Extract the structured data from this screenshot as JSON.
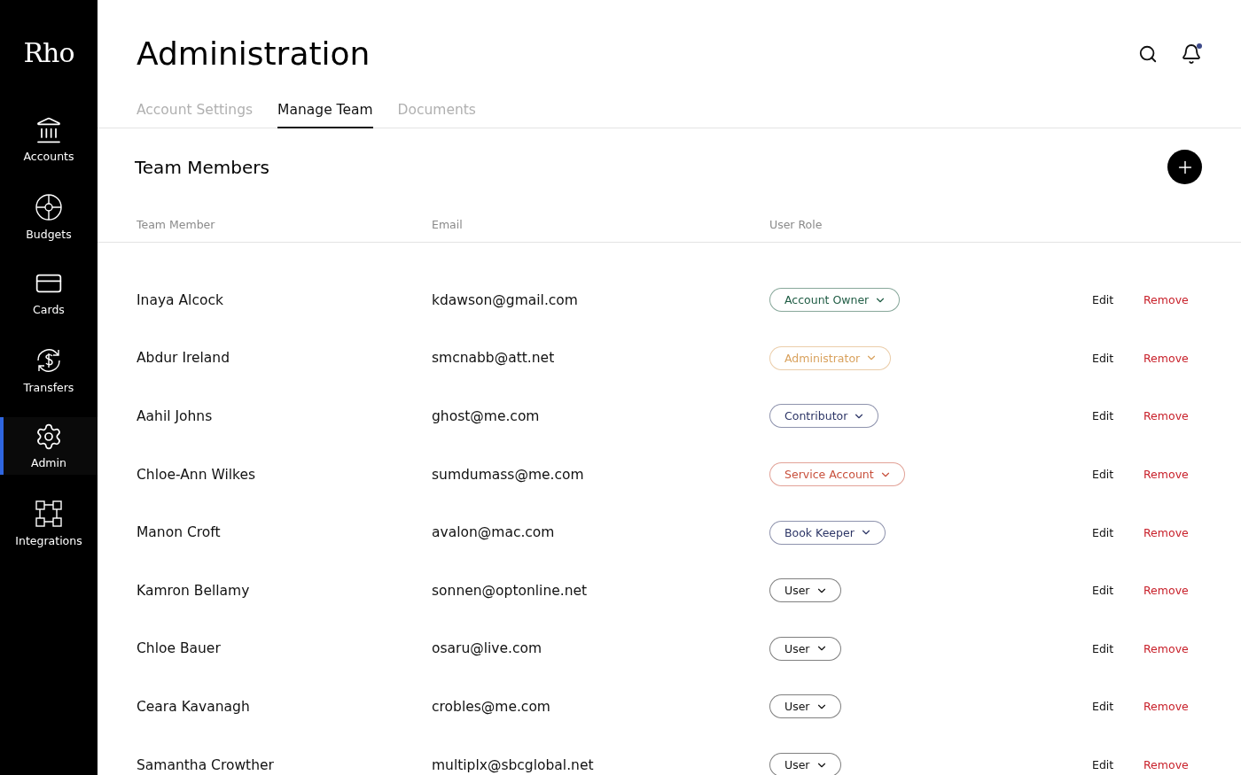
{
  "sidebar": {
    "logo": "Rho",
    "items": [
      {
        "label": "Accounts",
        "kind": "accounts",
        "selected": false
      },
      {
        "label": "Budgets",
        "kind": "budgets",
        "selected": false
      },
      {
        "label": "Cards",
        "kind": "cards",
        "selected": false
      },
      {
        "label": "Transfers",
        "kind": "transfers",
        "selected": false
      },
      {
        "label": "Admin",
        "kind": "admin",
        "selected": true
      },
      {
        "label": "Integrations",
        "kind": "integrations",
        "selected": false
      }
    ]
  },
  "header": {
    "title": "Administration",
    "notification_dot": true
  },
  "tabs": [
    {
      "label": "Account Settings",
      "selected": false
    },
    {
      "label": "Manage Team",
      "selected": true
    },
    {
      "label": "Documents",
      "selected": false
    }
  ],
  "section": {
    "title": "Team Members"
  },
  "table": {
    "columns": [
      "Team Member",
      "Email",
      "User Role"
    ],
    "rows": [
      {
        "name": "Inaya Alcock",
        "email": "kdawson@gmail.com",
        "role": "Account Owner",
        "color": "#1f5c44",
        "edit": "Edit",
        "remove": "Remove"
      },
      {
        "name": "Abdur Ireland",
        "email": "smcnabb@att.net",
        "role": "Administrator",
        "color": "#d9a25e",
        "edit": "Edit",
        "remove": "Remove"
      },
      {
        "name": "Aahil Johns",
        "email": "ghost@me.com",
        "role": "Contributor",
        "color": "#2c3566",
        "edit": "Edit",
        "remove": "Remove"
      },
      {
        "name": "Chloe-Ann Wilkes",
        "email": "sumdumass@me.com",
        "role": "Service Account",
        "color": "#c8503c",
        "edit": "Edit",
        "remove": "Remove"
      },
      {
        "name": "Manon Croft",
        "email": "avalon@mac.com",
        "role": "Book Keeper",
        "color": "#2c3566",
        "edit": "Edit",
        "remove": "Remove"
      },
      {
        "name": "Kamron Bellamy",
        "email": "sonnen@optonline.net",
        "role": "User",
        "color": "#111111",
        "edit": "Edit",
        "remove": "Remove"
      },
      {
        "name": "Chloe Bauer",
        "email": "osaru@live.com",
        "role": "User",
        "color": "#111111",
        "edit": "Edit",
        "remove": "Remove"
      },
      {
        "name": "Ceara Kavanagh",
        "email": "crobles@me.com",
        "role": "User",
        "color": "#111111",
        "edit": "Edit",
        "remove": "Remove"
      },
      {
        "name": "Samantha Crowther",
        "email": "multiplx@sbcglobal.net",
        "role": "User",
        "color": "#111111",
        "edit": "Edit",
        "remove": "Remove"
      }
    ]
  }
}
